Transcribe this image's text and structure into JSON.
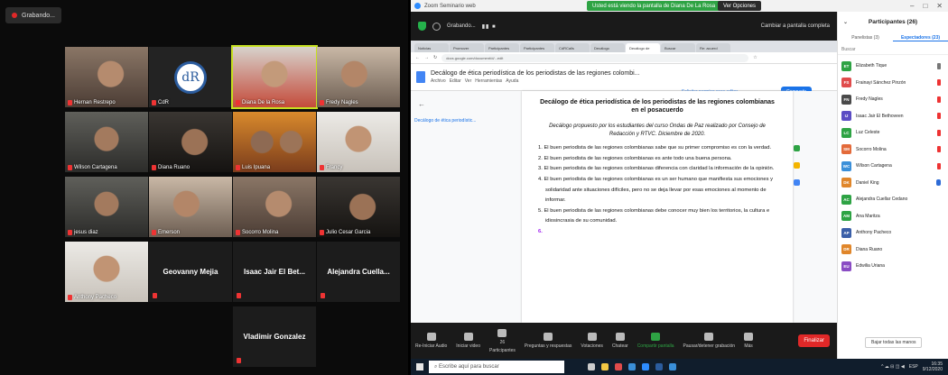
{
  "left": {
    "recording_label": "Grabando...",
    "tiles": [
      {
        "name": "Hernan Restrepo",
        "style": "warm"
      },
      {
        "name": "CdR",
        "style": "logo"
      },
      {
        "name": "Diana De la Rosa",
        "style": "red",
        "active": true
      },
      {
        "name": "Fredy Nagles",
        "style": "office"
      },
      {
        "name": "Wilson Cartagena",
        "style": "cool"
      },
      {
        "name": "Diana Ruano",
        "style": "dark"
      },
      {
        "name": "Luis Ipuana",
        "style": "orange"
      },
      {
        "name": "Francy",
        "style": "plain"
      },
      {
        "name": "jesus diaz",
        "style": "cool"
      },
      {
        "name": "Emerson",
        "style": "office"
      },
      {
        "name": "Socorro Molina",
        "style": "warm"
      },
      {
        "name": "Julio Cesar Garcia",
        "style": "dark"
      },
      {
        "name": "Anthony Pacheco",
        "style": "plain"
      },
      {
        "name": "Geovanny Mejia",
        "style": "text"
      },
      {
        "name": "Isaac Jair El Bet...",
        "style": "text"
      },
      {
        "name": "Alejandra Cuella...",
        "style": "text"
      },
      {
        "name": "Vladimir Gonzalez",
        "style": "text"
      }
    ]
  },
  "window": {
    "app_title": "Zoom Seminario web",
    "sharing_banner": "Usted está viendo la pantalla de Diana De La Rosa",
    "view_options": "Ver Opciones"
  },
  "meeting_bar": {
    "recording_label": "Grabando...",
    "fullscreen_label": "Cambiar a pantalla completa"
  },
  "browser": {
    "tabs": [
      "Noticias",
      "Promover",
      "Participantes",
      "Participantes",
      "CdRCalls",
      "Decálogo",
      "Decálogo de",
      "Buscar",
      "Re: acuerd"
    ],
    "url": "docs.google.com/document/d/...edit",
    "doc_title": "Decálogo de ética periodística de los periodistas de las regiones colombi...",
    "menu": [
      "Archivo",
      "Editar",
      "Ver",
      "Herramientas",
      "Ayuda"
    ],
    "request_edit": "Solicitar permiso para editar",
    "share_label": "Compartir",
    "outline_label": "Decálogo de ética periodístic..."
  },
  "document": {
    "heading": "Decálogo de ética periodística de los periodistas de las regiones colombianas en el posacuerdo",
    "intro": "Decálogo propuesto por los estudiantes del curso Ondas de Paz realizado por Consejo de Redacción y RTVC. Diciembre de 2020.",
    "items": [
      "1. El buen periodista de las regiones colombianas sabe que su primer compromiso es con la verdad.",
      "2. El buen periodista de las regiones colombianas es ante todo una buena persona.",
      "3. El buen periodista de las regiones colombianas diferencia con claridad la información de la opinión.",
      "4. El buen periodista de las regiones colombianas es un ser humano que manifiesta sus emociones y solidaridad ante situaciones difíciles, pero no se deja llevar por esas emociones al momento de informar.",
      "5. El buen periodista de las regiones colombianas debe conocer muy bien los territorios, la cultura e idiosincrasia de su comunidad."
    ],
    "cursor_item": "6."
  },
  "controls": {
    "items": [
      "Re-Iniciar Audio",
      "Iniciar video",
      "Participantes",
      "Preguntas y respuestas",
      "Votaciones",
      "Chatear",
      "Compartir pantalla",
      "Pausar/detener grabación",
      "Más"
    ],
    "participant_count": "26",
    "end_label": "Finalizar"
  },
  "panel": {
    "title": "Participantes (26)",
    "tab_panelists": "Panelistas (3)",
    "tab_attendees": "Espectadores (23)",
    "search_placeholder": "Buscar",
    "participants": [
      {
        "initials": "ET",
        "name": "Elizabeth Tique",
        "color": "#2ea344",
        "status": "mic"
      },
      {
        "initials": "FS",
        "name": "Frainayi Sánchez Pinzón",
        "color": "#e04b4b",
        "status": "mute"
      },
      {
        "initials": "FN",
        "name": "Fredy Nagles",
        "color": "#4a4a4a",
        "status": "mute"
      },
      {
        "initials": "IJ",
        "name": "Isaac Jair El Bethoveen",
        "color": "#5b4cc4",
        "status": "mute"
      },
      {
        "initials": "LC",
        "name": "Luz Celeste",
        "color": "#2ea344",
        "status": "mute"
      },
      {
        "initials": "SM",
        "name": "Socorro Molina",
        "color": "#e36a3a",
        "status": "mute"
      },
      {
        "initials": "WC",
        "name": "Wilson Cartagena",
        "color": "#3a8fd9",
        "status": "mute"
      },
      {
        "initials": "DK",
        "name": "Daniel King",
        "color": "#e0862a",
        "status": "hand"
      },
      {
        "initials": "AC",
        "name": "Alejandra Cuellar Cedano",
        "color": "#2ea344",
        "status": "none"
      },
      {
        "initials": "AM",
        "name": "Ana Maritza",
        "color": "#2ea344",
        "status": "none"
      },
      {
        "initials": "AP",
        "name": "Anthony Pacheco",
        "color": "#3a5fa8",
        "status": "none"
      },
      {
        "initials": "DR",
        "name": "Diana Ruano",
        "color": "#e0862a",
        "status": "none"
      },
      {
        "initials": "EU",
        "name": "Edwilia Uriana",
        "color": "#8a4cc4",
        "status": "none"
      }
    ],
    "lower_hands": "Bajar todas las manos"
  },
  "taskbar": {
    "search_placeholder": "Escribe aquí para buscar",
    "lang": "ESP",
    "time": "16:35",
    "date": "9/12/2020"
  }
}
